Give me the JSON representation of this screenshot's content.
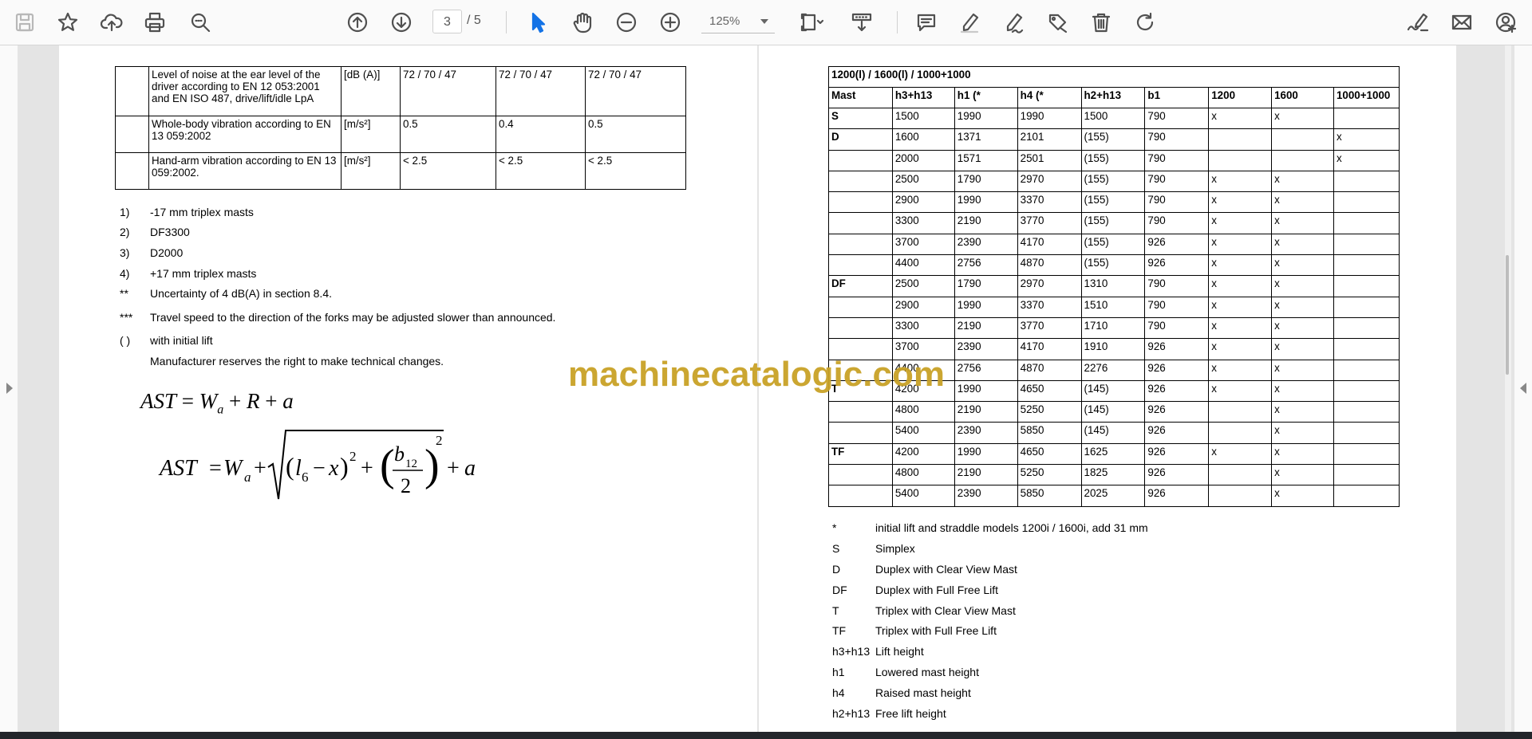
{
  "toolbar": {
    "current_page": "3",
    "total_pages": "/ 5",
    "zoom": "125%"
  },
  "left_table": {
    "rows": [
      {
        "desc": "Level of noise at the ear level of the driver according to EN 12 053:2001 and EN ISO 487, drive/lift/idle LpA",
        "unit": "[dB (A)]",
        "v1": "72 / 70 / 47",
        "v2": "72 / 70 / 47",
        "v3": "72 / 70 / 47"
      },
      {
        "desc": "Whole-body vibration according to EN 13 059:2002",
        "unit": "[m/s²]",
        "v1": "0.5",
        "v2": "0.4",
        "v3": "0.5"
      },
      {
        "desc": "Hand-arm vibration according to EN 13 059:2002.",
        "unit": "[m/s²]",
        "v1": "< 2.5",
        "v2": "< 2.5",
        "v3": "< 2.5"
      }
    ]
  },
  "left_notes": [
    {
      "key": "1)",
      "text": "-17 mm triplex masts"
    },
    {
      "key": "2)",
      "text": "DF3300"
    },
    {
      "key": "3)",
      "text": "D2000"
    },
    {
      "key": "4)",
      "text": "+17 mm triplex masts"
    },
    {
      "key": "**",
      "text": "Uncertainty of 4 dB(A) in section 8.4."
    },
    {
      "key": "***",
      "text": "Travel speed to the direction of the forks may be adjusted slower than announced."
    },
    {
      "key": "( )",
      "text": "with initial lift"
    },
    {
      "key": "",
      "text": "Manufacturer reserves the right to make technical changes."
    }
  ],
  "formula": {
    "line1_lhs": "AST",
    "line2_lhs": "AST"
  },
  "mast_table": {
    "title": "1200(l) / 1600(l) / 1000+1000",
    "headers": [
      "Mast",
      "h3+h13",
      "h1 (*",
      "h4 (*",
      "h2+h13",
      "b1",
      "1200",
      "1600",
      "1000+1000"
    ],
    "rows": [
      [
        "S",
        "1500",
        "1990",
        "1990",
        "1500",
        "790",
        "x",
        "x",
        ""
      ],
      [
        "D",
        "1600",
        "1371",
        "2101",
        "(155)",
        "790",
        "",
        "",
        "x"
      ],
      [
        "",
        "2000",
        "1571",
        "2501",
        "(155)",
        "790",
        "",
        "",
        "x"
      ],
      [
        "",
        "2500",
        "1790",
        "2970",
        "(155)",
        "790",
        "x",
        "x",
        ""
      ],
      [
        "",
        "2900",
        "1990",
        "3370",
        "(155)",
        "790",
        "x",
        "x",
        ""
      ],
      [
        "",
        "3300",
        "2190",
        "3770",
        "(155)",
        "790",
        "x",
        "x",
        ""
      ],
      [
        "",
        "3700",
        "2390",
        "4170",
        "(155)",
        "926",
        "x",
        "x",
        ""
      ],
      [
        "",
        "4400",
        "2756",
        "4870",
        "(155)",
        "926",
        "x",
        "x",
        ""
      ],
      [
        "DF",
        "2500",
        "1790",
        "2970",
        "1310",
        "790",
        "x",
        "x",
        ""
      ],
      [
        "",
        "2900",
        "1990",
        "3370",
        "1510",
        "790",
        "x",
        "x",
        ""
      ],
      [
        "",
        "3300",
        "2190",
        "3770",
        "1710",
        "790",
        "x",
        "x",
        ""
      ],
      [
        "",
        "3700",
        "2390",
        "4170",
        "1910",
        "926",
        "x",
        "x",
        ""
      ],
      [
        "",
        "4400",
        "2756",
        "4870",
        "2276",
        "926",
        "x",
        "x",
        ""
      ],
      [
        "T",
        "4200",
        "1990",
        "4650",
        "(145)",
        "926",
        "x",
        "x",
        ""
      ],
      [
        "",
        "4800",
        "2190",
        "5250",
        "(145)",
        "926",
        "",
        "x",
        ""
      ],
      [
        "",
        "5400",
        "2390",
        "5850",
        "(145)",
        "926",
        "",
        "x",
        ""
      ],
      [
        "TF",
        "4200",
        "1990",
        "4650",
        "1625",
        "926",
        "x",
        "x",
        ""
      ],
      [
        "",
        "4800",
        "2190",
        "5250",
        "1825",
        "926",
        "",
        "x",
        ""
      ],
      [
        "",
        "5400",
        "2390",
        "5850",
        "2025",
        "926",
        "",
        "x",
        ""
      ]
    ]
  },
  "right_notes": [
    {
      "key": "*",
      "text": "initial lift and straddle models 1200i / 1600i, add 31 mm"
    },
    {
      "key": "S",
      "text": "Simplex"
    },
    {
      "key": "D",
      "text": "Duplex with Clear View Mast"
    },
    {
      "key": "DF",
      "text": "Duplex with Full Free Lift"
    },
    {
      "key": "T",
      "text": "Triplex with Clear View Mast"
    },
    {
      "key": "TF",
      "text": "Triplex with Full Free Lift"
    },
    {
      "key": "h3+h13",
      "text": "Lift height"
    },
    {
      "key": "h1",
      "text": "Lowered mast height"
    },
    {
      "key": "h4",
      "text": "Raised mast height"
    },
    {
      "key": "h2+h13",
      "text": "Free lift height"
    }
  ],
  "watermark": "machinecatalogic.com"
}
